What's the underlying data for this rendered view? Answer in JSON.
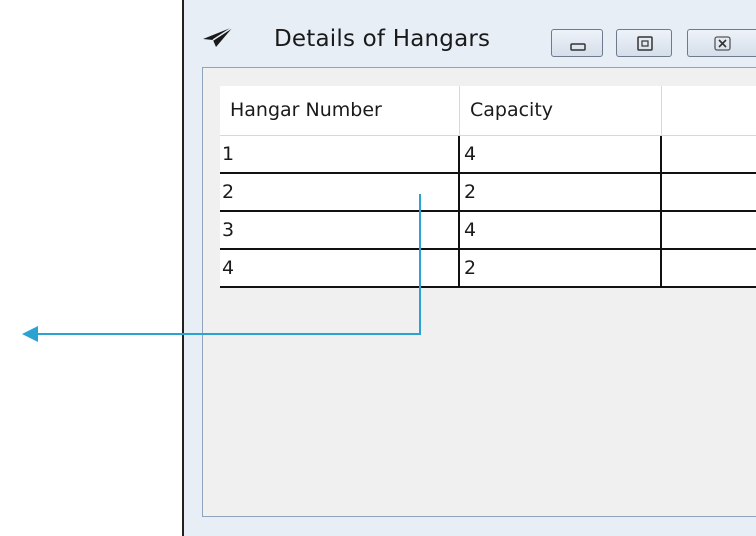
{
  "window": {
    "title": "Details of Hangars"
  },
  "icons": {
    "app": "paper-plane-icon",
    "minimize": "minimize-icon",
    "maximize": "maximize-icon",
    "close": "close-icon",
    "callout": "arrow-left-icon"
  },
  "grid": {
    "columns": [
      "Hangar Number",
      "Capacity"
    ],
    "rows": [
      [
        "1",
        "4"
      ],
      [
        "2",
        "2"
      ],
      [
        "3",
        "4"
      ],
      [
        "4",
        "2"
      ]
    ]
  },
  "colors": {
    "callout_arrow": "#2aa3d2"
  }
}
